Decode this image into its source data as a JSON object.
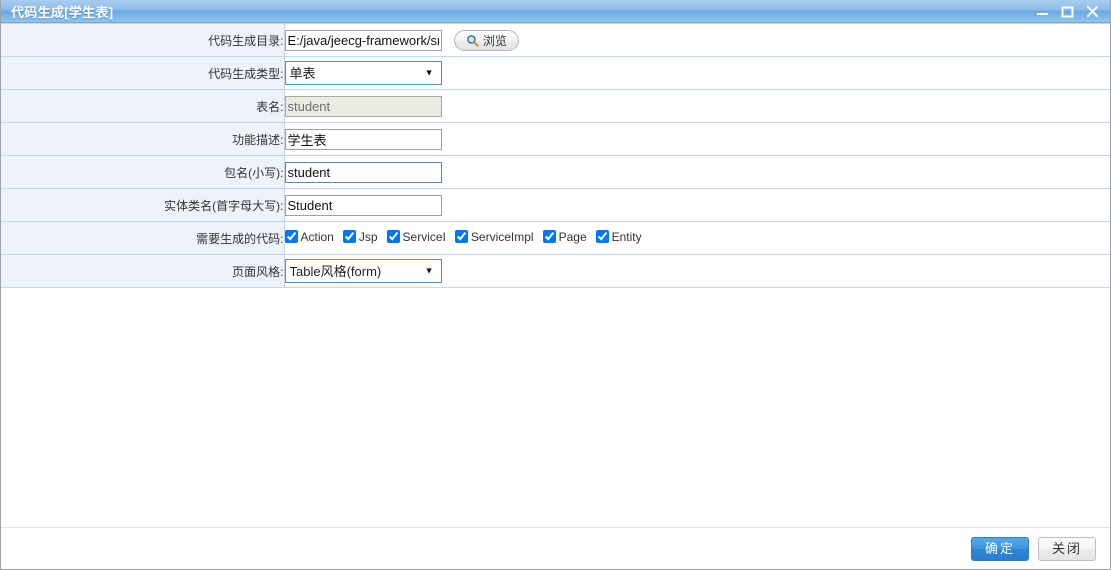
{
  "window": {
    "title": "代码生成[学生表]",
    "controls": [
      {
        "name": "minimize",
        "glyph": "minimize-icon"
      },
      {
        "name": "maximize",
        "glyph": "maximize-icon"
      },
      {
        "name": "close",
        "glyph": "close-icon"
      }
    ]
  },
  "form": {
    "rows": [
      {
        "label": "代码生成目录:",
        "value": "E:/java/jeecg-framework/src"
      },
      {
        "label": "代码生成类型:",
        "value": "单表"
      },
      {
        "label": "表名:",
        "value": "student"
      },
      {
        "label": "功能描述:",
        "value": "学生表"
      },
      {
        "label": "包名(小写):",
        "value": "student"
      },
      {
        "label": "实体类名(首字母大写):",
        "value": "Student"
      },
      {
        "label": "需要生成的代码:",
        "value": ""
      },
      {
        "label": "页面风格:",
        "value": "Table风格(form)"
      }
    ],
    "browse_button": {
      "label": "浏览",
      "icon": "search-icon"
    },
    "gen_type_options": [
      "单表"
    ],
    "page_style_options": [
      "Table风格(form)"
    ],
    "checkboxes": [
      {
        "label": "Action",
        "checked": true
      },
      {
        "label": "Jsp",
        "checked": true
      },
      {
        "label": "ServiceI",
        "checked": true
      },
      {
        "label": "ServiceImpl",
        "checked": true
      },
      {
        "label": "Page",
        "checked": true
      },
      {
        "label": "Entity",
        "checked": true
      }
    ]
  },
  "footer": {
    "confirm_label": "确定",
    "close_label": "关闭"
  },
  "colors": {
    "title_bar_blue": "#6aaae2",
    "label_cell_bg": "#eef3fb",
    "row_border": "#c4d5ea",
    "primary_button": "#2f86d4",
    "focused_border": "#4a90c8",
    "disabled_field_bg": "#ebebe4"
  }
}
